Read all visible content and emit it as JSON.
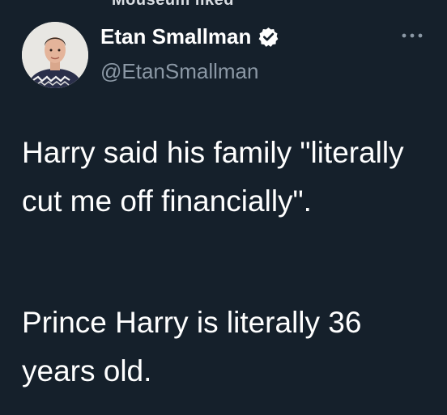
{
  "header": {
    "retweet_label": "Mouseum liked"
  },
  "author": {
    "display_name": "Etan Smallman",
    "handle": "@EtanSmallman",
    "verified": true,
    "avatar_icon": "profile-photo-icon"
  },
  "tweet": {
    "paragraphs": [
      "Harry said his family \"literally cut me off financially\".",
      "Prince Harry is literally 36 years old."
    ]
  },
  "colors": {
    "background": "#15202b",
    "text": "#ffffff",
    "secondary_text": "#8b98a5",
    "verified_badge": "#ffffff"
  }
}
